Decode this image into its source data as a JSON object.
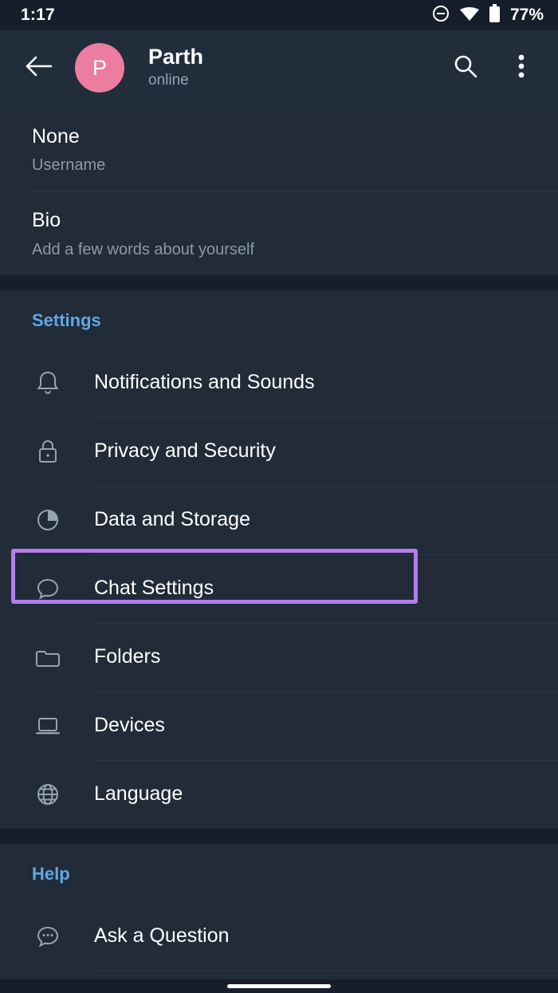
{
  "status_bar": {
    "time": "1:17",
    "battery_percent": "77%",
    "icons": [
      "do-not-disturb-icon",
      "wifi-icon",
      "battery-icon"
    ]
  },
  "app_bar": {
    "back_icon": "back-arrow-icon",
    "avatar_letter": "P",
    "avatar_color": "#ec7d9f",
    "title": "Parth",
    "subtitle": "online",
    "search_icon": "search-icon",
    "overflow_icon": "more-vertical-icon"
  },
  "profile": [
    {
      "value": "None",
      "label": "Username"
    },
    {
      "value": "Bio",
      "label": "Add a few words about yourself"
    }
  ],
  "settings_section": {
    "header": "Settings",
    "accent_color": "#5fa8e4",
    "items": [
      {
        "label": "Notifications and Sounds",
        "icon": "bell-icon"
      },
      {
        "label": "Privacy and Security",
        "icon": "lock-icon"
      },
      {
        "label": "Data and Storage",
        "icon": "pie-chart-icon"
      },
      {
        "label": "Chat Settings",
        "icon": "chat-bubble-icon",
        "highlighted": true
      },
      {
        "label": "Folders",
        "icon": "folder-icon"
      },
      {
        "label": "Devices",
        "icon": "laptop-icon"
      },
      {
        "label": "Language",
        "icon": "globe-icon"
      }
    ]
  },
  "help_section": {
    "header": "Help",
    "items": [
      {
        "label": "Ask a Question",
        "icon": "chat-dots-icon"
      }
    ]
  },
  "highlight": {
    "color": "#b57ced",
    "target": "Chat Settings"
  },
  "nav_bar": {
    "handle": "home-gesture-pill"
  }
}
